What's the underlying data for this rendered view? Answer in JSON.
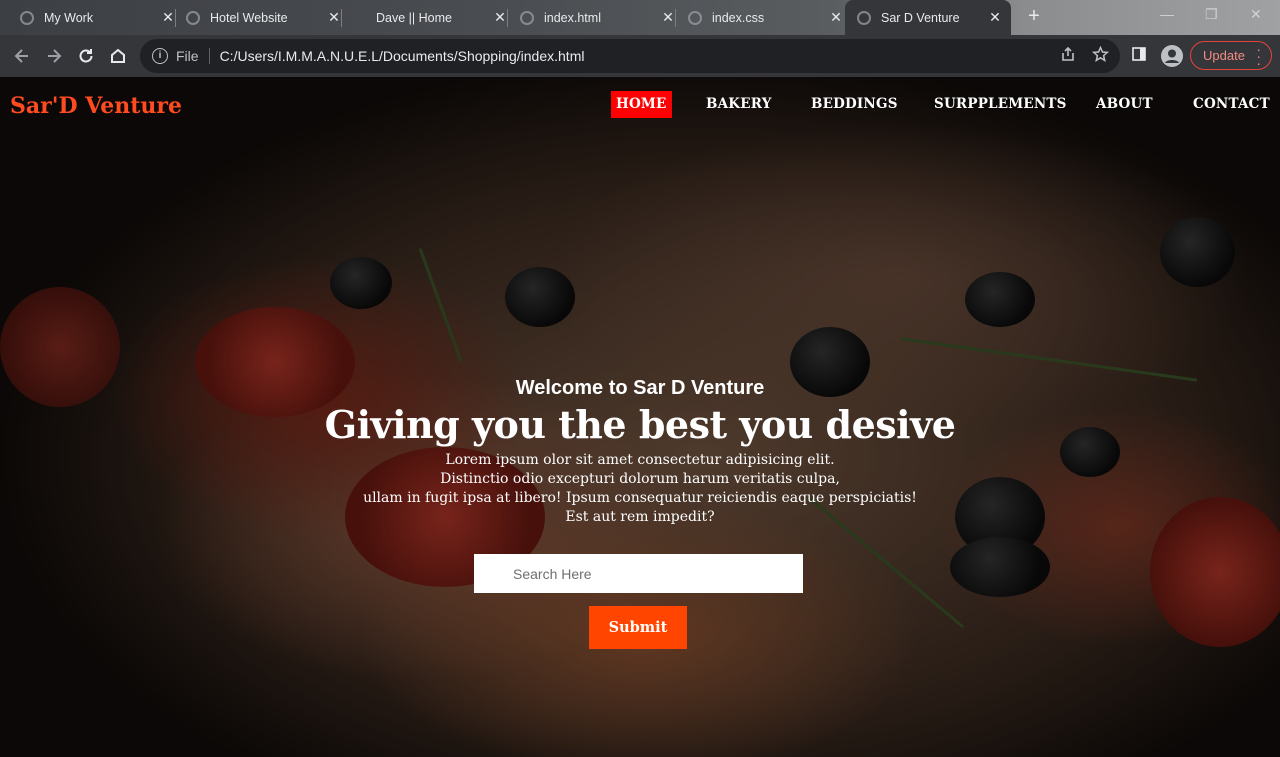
{
  "browser": {
    "tabs": [
      {
        "title": "My Work",
        "active": false
      },
      {
        "title": "Hotel Website",
        "active": false
      },
      {
        "title": "Dave || Home",
        "active": false
      },
      {
        "title": "index.html",
        "active": false
      },
      {
        "title": "index.css",
        "active": false
      },
      {
        "title": "Sar D Venture",
        "active": true
      }
    ],
    "address": {
      "scheme_label": "File",
      "url": "C:/Users/I.M.M.A.N.U.E.L/Documents/Shopping/index.html"
    },
    "update_label": "Update"
  },
  "page": {
    "brand": "Sar'D Venture",
    "nav": [
      {
        "label": "HOME",
        "active": true
      },
      {
        "label": "BAKERY",
        "active": false
      },
      {
        "label": "BEDDINGS",
        "active": false
      },
      {
        "label": "SURPPLEMENTS",
        "active": false
      },
      {
        "label": "ABOUT",
        "active": false
      },
      {
        "label": "CONTACT",
        "active": false
      }
    ],
    "hero": {
      "welcome": "Welcome to Sar D Venture",
      "headline": "Giving you the best you desive",
      "lead_lines": [
        "Lorem ipsum olor sit amet consectetur adipisicing elit.",
        "Distinctio odio excepturi dolorum harum veritatis culpa,",
        "ullam in fugit ipsa at libero! Ipsum consequatur reiciendis eaque perspiciatis!",
        "Est aut rem impedit?"
      ]
    },
    "search": {
      "placeholder": "Search Here",
      "value": ""
    },
    "submit_label": "Submit"
  },
  "colors": {
    "brand": "#ff4b1f",
    "nav_active_bg": "#ff0000",
    "submit_bg": "#ff4500",
    "update_border": "#e2443a"
  }
}
